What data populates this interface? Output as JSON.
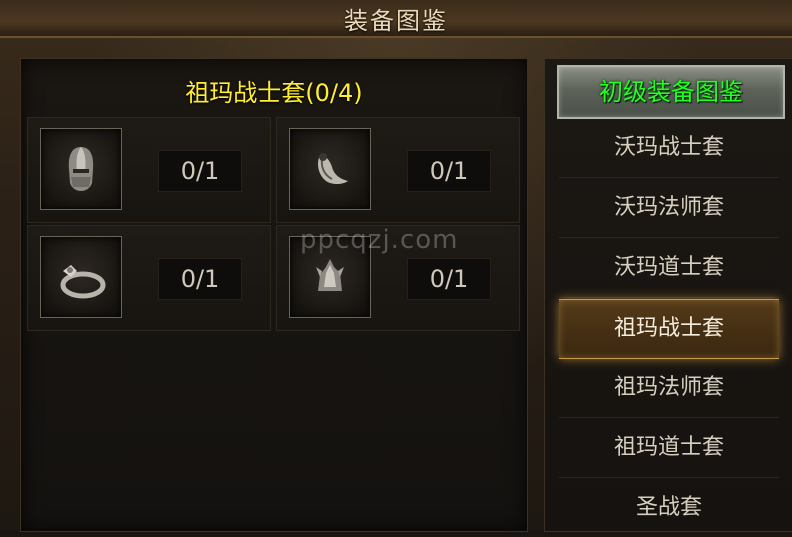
{
  "window": {
    "title": "装备图鉴"
  },
  "set": {
    "title": "祖玛战士套(0/4)"
  },
  "slots": [
    {
      "icon": "helmet-icon",
      "count": "0/1"
    },
    {
      "icon": "necklace-icon",
      "count": "0/1"
    },
    {
      "icon": "ring-icon",
      "count": "0/1"
    },
    {
      "icon": "bracelet-icon",
      "count": "0/1"
    }
  ],
  "watermark": "ppcqzj.com",
  "sidebar": {
    "header": "初级装备图鉴",
    "items": [
      {
        "label": "沃玛战士套",
        "active": false
      },
      {
        "label": "沃玛法师套",
        "active": false
      },
      {
        "label": "沃玛道士套",
        "active": false
      },
      {
        "label": "祖玛战士套",
        "active": true
      },
      {
        "label": "祖玛法师套",
        "active": false
      },
      {
        "label": "祖玛道士套",
        "active": false
      },
      {
        "label": "圣战套",
        "active": false
      }
    ]
  },
  "colors": {
    "set_title": "#ffee33",
    "header_text": "#22ff22",
    "active_glow": "#c99a4a"
  }
}
